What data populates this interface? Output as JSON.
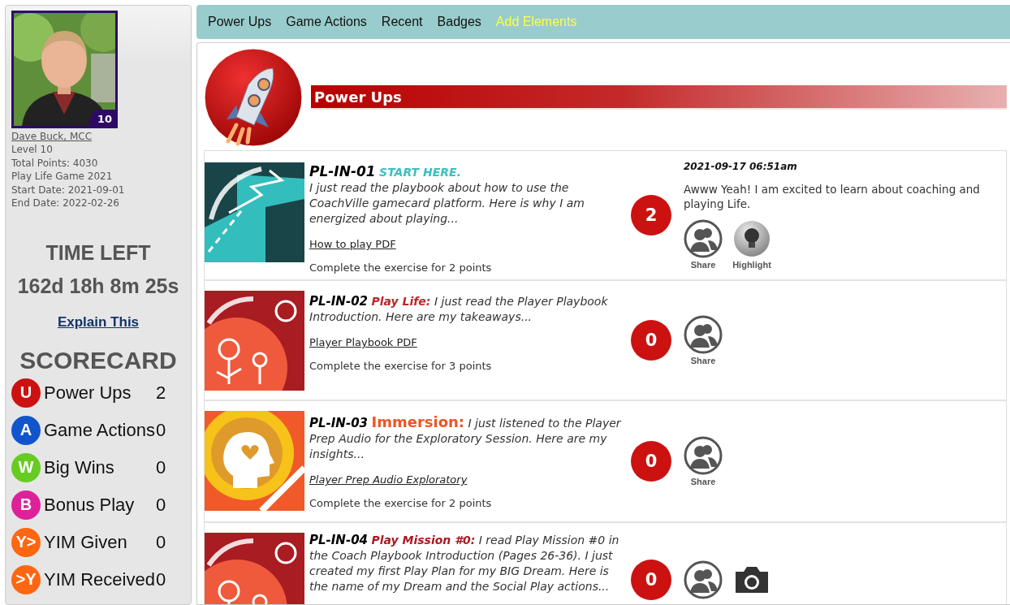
{
  "profile": {
    "name": "Dave Buck, MCC",
    "level_badge": "10",
    "details": [
      "Level 10",
      "Total Points: 4030",
      "Play Life Game 2021",
      "Start Date: 2021-09-01",
      "End Date: 2022-02-26"
    ]
  },
  "timer": {
    "title": "TIME LEFT",
    "value": "162d 18h 8m 25s",
    "link": "Explain This"
  },
  "scorecard": {
    "title": "SCORECARD",
    "items": [
      {
        "badge": "U",
        "color": "#cc1111",
        "label": "Power Ups",
        "value": "2"
      },
      {
        "badge": "A",
        "color": "#1155cc",
        "label": "Game Actions",
        "value": "0"
      },
      {
        "badge": "W",
        "color": "#66cc22",
        "label": "Big Wins",
        "value": "0"
      },
      {
        "badge": "B",
        "color": "#dd2299",
        "label": "Bonus Play",
        "value": "0"
      },
      {
        "badge": "Y>",
        "color": "#ff6611",
        "label": "YIM Given",
        "value": "0"
      },
      {
        "badge": ">Y",
        "color": "#ff6611",
        "label": "YIM Received",
        "value": "0"
      }
    ]
  },
  "nav": [
    {
      "label": "Power Ups",
      "kind": "tab"
    },
    {
      "label": "Game Actions",
      "kind": "tab"
    },
    {
      "label": "Recent",
      "kind": "tab"
    },
    {
      "label": "Badges",
      "kind": "tab"
    },
    {
      "label": "Add Elements",
      "kind": "action"
    }
  ],
  "section": {
    "title": "Power Ups"
  },
  "rows": [
    {
      "code": "PL-IN-01",
      "tag": "START HERE.",
      "color": "#3cbfbf",
      "description": "I just read the playbook about how to use the CoachVille gamecard platform. Here is why I am energized about playing...",
      "link": "How to play PDF",
      "note": "Complete the exercise for 2 points",
      "score": "2",
      "date": "2021-09-17 06:51am",
      "comment": "Awww Yeah! I am excited to learn about coaching and playing Life.",
      "actions": [
        {
          "kind": "share",
          "label": "Share"
        },
        {
          "kind": "highlight",
          "label": "Highlight"
        }
      ]
    },
    {
      "code": "PL-IN-02",
      "tag": "Play Life:",
      "color": "#c0242a",
      "text": "I just read the Player Playbook Introduction. Here are my takeaways...",
      "link": "Player Playbook PDF",
      "note": "Complete the exercise for 3 points",
      "score": "0",
      "actions": [
        {
          "kind": "share",
          "label": "Share"
        }
      ]
    },
    {
      "code": "PL-IN-03",
      "tag": "Immersion:",
      "color": "#ee5522",
      "text": "I just listened to the Player Prep Audio for the Exploratory Session. Here are my insights...",
      "link": "Player Prep Audio Exploratory",
      "note": "Complete the exercise for 2 points",
      "score": "0",
      "actions": [
        {
          "kind": "share",
          "label": "Share"
        }
      ]
    },
    {
      "code": "PL-IN-04",
      "tag": "Play Mission #0:",
      "color": "#aa1a22",
      "text": "I read Play Mission #0 in the Coach Playbook Introduction (Pages 26-36). I just created my first Play Plan for my BIG Dream.  Here is the name of my Dream and the Social Play actions...",
      "score": "0",
      "actions": [
        {
          "kind": "share"
        },
        {
          "kind": "camera"
        }
      ]
    }
  ]
}
